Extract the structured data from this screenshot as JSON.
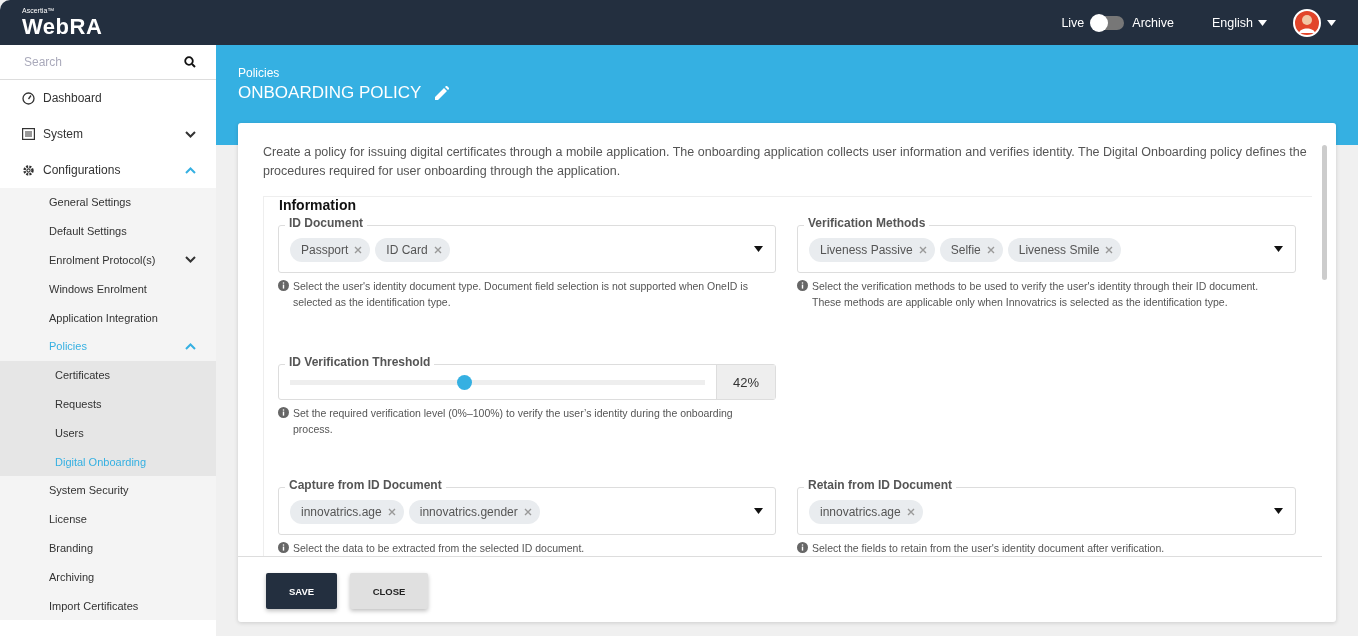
{
  "header": {
    "brand_small": "Ascertia™",
    "brand": "WebRA",
    "mode_toggle": {
      "left_label": "Live",
      "right_label": "Archive",
      "on": false
    },
    "language": "English"
  },
  "sidebar": {
    "search": {
      "placeholder": "Search"
    },
    "items": [
      {
        "label": "Dashboard",
        "selected": false
      },
      {
        "label": "System",
        "selected": false,
        "expanded": false
      },
      {
        "label": "Configurations",
        "selected": false,
        "expanded": true,
        "children": [
          {
            "label": "General Settings",
            "selected": false
          },
          {
            "label": "Default Settings",
            "selected": false
          },
          {
            "label": "Enrolment Protocol(s)",
            "selected": false,
            "expanded": false
          },
          {
            "label": "Windows Enrolment",
            "selected": false
          },
          {
            "label": "Application Integration",
            "selected": false
          },
          {
            "label": "Policies",
            "selected": true,
            "expanded": true,
            "children": [
              {
                "label": "Certificates",
                "selected": false
              },
              {
                "label": "Requests",
                "selected": false
              },
              {
                "label": "Users",
                "selected": false
              },
              {
                "label": "Digital Onboarding",
                "selected": true
              }
            ]
          },
          {
            "label": "System Security",
            "selected": false
          },
          {
            "label": "License",
            "selected": false
          },
          {
            "label": "Branding",
            "selected": false
          },
          {
            "label": "Archiving",
            "selected": false
          },
          {
            "label": "Import Certificates",
            "selected": false
          }
        ]
      }
    ]
  },
  "page": {
    "breadcrumb": "Policies",
    "title": "ONBOARDING POLICY"
  },
  "form": {
    "description": "Create a policy for issuing digital certificates through a mobile application. The onboarding application collects user information and verifies identity. The Digital Onboarding policy defines the procedures required for user onboarding through the application.",
    "section_title": "Information",
    "rows": [
      {
        "fields": [
          {
            "kind": "multiselect",
            "label": "ID Document",
            "chips": [
              "Passport",
              "ID Card"
            ],
            "help": "Select the user's identity document type. Document field selection is not supported when OneID is selected as the identification type."
          },
          {
            "kind": "multiselect",
            "label": "Verification Methods",
            "chips": [
              "Liveness Passive",
              "Selfie",
              "Liveness Smile"
            ],
            "help": "Select the verification methods to be used to verify the user's identity through their ID document. These methods are applicable only when Innovatrics is selected as the identification type."
          }
        ]
      },
      {
        "fields": [
          {
            "kind": "slider",
            "label": "ID Verification Threshold",
            "level": 0.42,
            "reading": "42%",
            "help": "Set the required verification level (0%–100%) to verify the user’s identity during the onboarding process."
          }
        ]
      },
      {
        "fields": [
          {
            "kind": "multiselect",
            "label": "Capture from ID Document",
            "chips": [
              "innovatrics.age",
              "innovatrics.gender"
            ],
            "help": "Select the data to be extracted from the selected ID document."
          },
          {
            "kind": "multiselect",
            "label": "Retain from ID Document",
            "chips": [
              "innovatrics.age"
            ],
            "help": "Select the fields to retain from the user's identity document after verification."
          }
        ]
      }
    ],
    "buttons": [
      {
        "label": "SAVE",
        "kind": "primary"
      },
      {
        "label": "CLOSE",
        "kind": "secondary"
      }
    ]
  }
}
